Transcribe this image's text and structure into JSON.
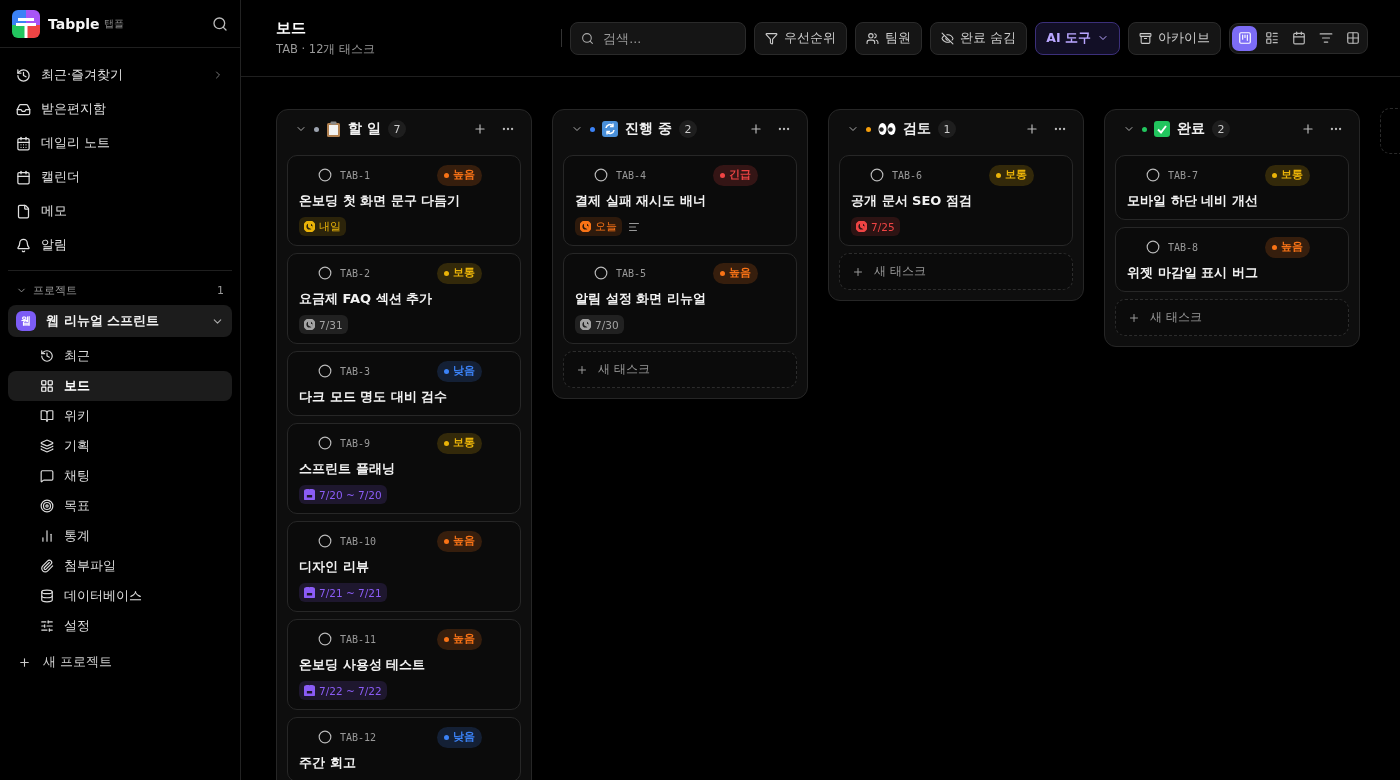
{
  "app": {
    "name": "Tabple",
    "subname": "탭플"
  },
  "nav": [
    {
      "label": "최근·즐겨찾기",
      "has_submenu": true
    },
    {
      "label": "받은편지함",
      "has_submenu": false
    },
    {
      "label": "데일리 노트",
      "has_submenu": false
    },
    {
      "label": "캘린더",
      "has_submenu": false
    },
    {
      "label": "메모",
      "has_submenu": false
    },
    {
      "label": "알림",
      "has_submenu": false
    }
  ],
  "projects": {
    "heading": "프로젝트",
    "count": "1",
    "expanded": true,
    "items": [
      {
        "avatar": "웹",
        "name": "웹 리뉴얼 스프린트",
        "expanded": true,
        "children": [
          {
            "label": "최근",
            "selected": false
          },
          {
            "label": "보드",
            "selected": true
          },
          {
            "label": "위키",
            "selected": false
          },
          {
            "label": "기획",
            "selected": false
          },
          {
            "label": "채팅",
            "selected": false
          },
          {
            "label": "목표",
            "selected": false
          },
          {
            "label": "통계",
            "selected": false
          },
          {
            "label": "첨부파일",
            "selected": false
          },
          {
            "label": "데이터베이스",
            "selected": false
          },
          {
            "label": "설정",
            "selected": false
          }
        ]
      }
    ],
    "new_project": "새 프로젝트"
  },
  "header": {
    "title": "보드",
    "subtitle": "TAB · 12개 태스크"
  },
  "toolbar": {
    "search": {
      "placeholder": "검색..."
    },
    "buttons": [
      {
        "label": "우선순위",
        "kind": "filter"
      },
      {
        "label": "팀원",
        "kind": "users"
      },
      {
        "label": "완료 숨김",
        "kind": "hide"
      },
      {
        "label": "AI 도구",
        "kind": "ai"
      },
      {
        "label": "아카이브",
        "kind": "archive"
      }
    ],
    "views": [
      {
        "kind": "kanban",
        "selected": true
      },
      {
        "kind": "list",
        "selected": false
      },
      {
        "kind": "calendar",
        "selected": false
      },
      {
        "kind": "timeline",
        "selected": false
      },
      {
        "kind": "table",
        "selected": false
      }
    ]
  },
  "columns": [
    {
      "title": "할 일",
      "color": "#9ca3af",
      "count": "7",
      "cards": [
        {
          "id": "TAB-1",
          "done": false,
          "priority": {
            "label": "높음",
            "color": "#f97316"
          },
          "title": "온보딩 첫 화면 문구 다듬기",
          "due": {
            "text": "내일",
            "kind": "clock",
            "color": "#eab308"
          }
        },
        {
          "id": "TAB-2",
          "done": false,
          "priority": {
            "label": "보통",
            "color": "#eab308"
          },
          "title": "요금제 FAQ 섹션 추가",
          "due": {
            "text": "7/31",
            "kind": "clock",
            "color": "#a3a3a3"
          }
        },
        {
          "id": "TAB-3",
          "done": false,
          "priority": {
            "label": "낮음",
            "color": "#3b82f6"
          },
          "title": "다크 모드 명도 대비 검수"
        },
        {
          "id": "TAB-9",
          "done": false,
          "priority": {
            "label": "보통",
            "color": "#eab308"
          },
          "title": "스프린트 플래닝",
          "due": {
            "text": "7/20 ~ 7/20",
            "kind": "range",
            "color": "#8b5cf6"
          }
        },
        {
          "id": "TAB-10",
          "done": false,
          "priority": {
            "label": "높음",
            "color": "#f97316"
          },
          "title": "디자인 리뷰",
          "due": {
            "text": "7/21 ~ 7/21",
            "kind": "range",
            "color": "#8b5cf6"
          }
        },
        {
          "id": "TAB-11",
          "done": false,
          "priority": {
            "label": "높음",
            "color": "#f97316"
          },
          "title": "온보딩 사용성 테스트",
          "due": {
            "text": "7/22 ~ 7/22",
            "kind": "range",
            "color": "#8b5cf6"
          }
        },
        {
          "id": "TAB-12",
          "done": false,
          "priority": {
            "label": "낮음",
            "color": "#3b82f6"
          },
          "title": "주간 회고"
        }
      ]
    },
    {
      "title": "진행 중",
      "color": "#3b82f6",
      "count": "2",
      "add_label": "새 태스크",
      "cards": [
        {
          "id": "TAB-4",
          "done": false,
          "priority": {
            "label": "긴급",
            "color": "#ef4444"
          },
          "title": "결제 실패 재시도 배너",
          "due": {
            "text": "오늘",
            "kind": "clock",
            "color": "#f97316"
          },
          "has_description": true
        },
        {
          "id": "TAB-5",
          "done": false,
          "priority": {
            "label": "높음",
            "color": "#f97316"
          },
          "title": "알림 설정 화면 리뉴얼",
          "due": {
            "text": "7/30",
            "kind": "clock",
            "color": "#a3a3a3"
          }
        }
      ]
    },
    {
      "title": "검토",
      "color": "#f59e0b",
      "count": "1",
      "add_label": "새 태스크",
      "cards": [
        {
          "id": "TAB-6",
          "done": false,
          "priority": {
            "label": "보통",
            "color": "#eab308"
          },
          "title": "공개 문서 SEO 점검",
          "due": {
            "text": "7/25",
            "kind": "clock",
            "color": "#ef4444"
          }
        }
      ]
    },
    {
      "title": "완료",
      "color": "#22c55e",
      "count": "2",
      "add_label": "새 태스크",
      "cards": [
        {
          "id": "TAB-7",
          "done": false,
          "priority": {
            "label": "보통",
            "color": "#eab308"
          },
          "title": "모바일 하단 네비 개선"
        },
        {
          "id": "TAB-8",
          "done": false,
          "priority": {
            "label": "높음",
            "color": "#f97316"
          },
          "title": "위젯 마감일 표시 버그"
        }
      ]
    }
  ]
}
